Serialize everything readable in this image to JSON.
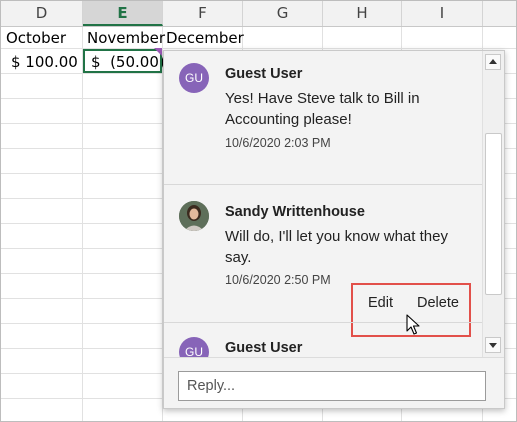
{
  "columns": [
    "D",
    "E",
    "F",
    "G",
    "H",
    "I"
  ],
  "selected_column": "E",
  "cells": {
    "d1": "October",
    "e1": "November",
    "f1": "December",
    "d2": "$ 100.00",
    "e2": "$  (50.00)"
  },
  "comments": [
    {
      "initials": "GU",
      "author": "Guest User",
      "message": "Yes! Have Steve talk to Bill in Accounting please!",
      "time": "10/6/2020 2:03 PM"
    },
    {
      "author": "Sandy Writtenhouse",
      "message": "Will do, I'll let you know what they say.",
      "time": "10/6/2020 2:50 PM",
      "actions": {
        "edit": "Edit",
        "delete": "Delete"
      }
    },
    {
      "initials": "GU",
      "author": "Guest User"
    }
  ],
  "reply": {
    "placeholder": "Reply..."
  },
  "colors": {
    "excel_green": "#217346",
    "avatar_purple": "#8764b8",
    "highlight_red": "#e2504a"
  }
}
